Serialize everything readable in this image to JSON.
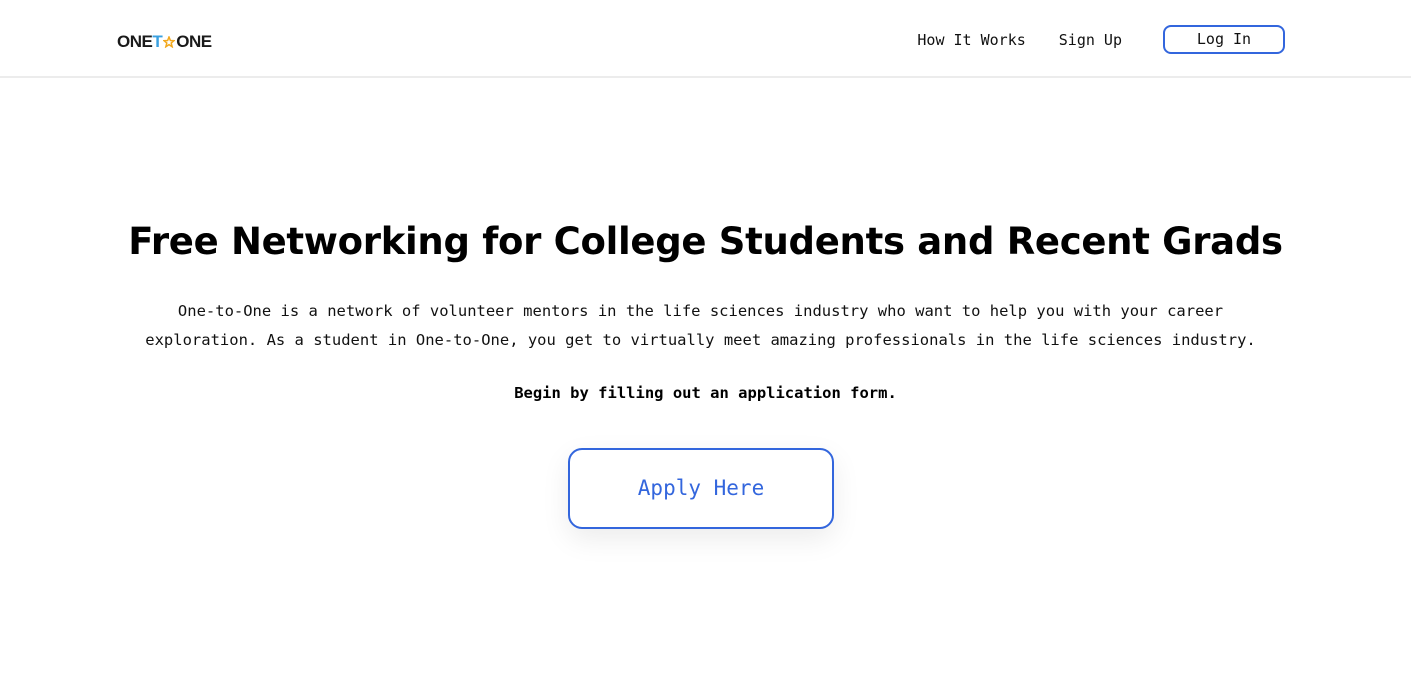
{
  "header": {
    "logo": {
      "part1": "ONE",
      "part2": "T",
      "part3": "ONE"
    },
    "nav": {
      "how_it_works": "How It Works",
      "sign_up": "Sign Up",
      "log_in": "Log In"
    }
  },
  "hero": {
    "title": "Free Networking for College Students and Recent Grads",
    "description": "One-to-One is a network of volunteer mentors in the life sciences industry who want to help you with your career exploration. As a student in One-to-One, you get to virtually meet amazing professionals in the life sciences industry.",
    "cta_text": "Begin by filling out an application form.",
    "apply_button": "Apply Here"
  },
  "colors": {
    "accent": "#3366dd",
    "logo_t": "#3aa0e0",
    "logo_star": "#f2a81d"
  },
  "icons": {
    "logo_star": "star-icon"
  }
}
